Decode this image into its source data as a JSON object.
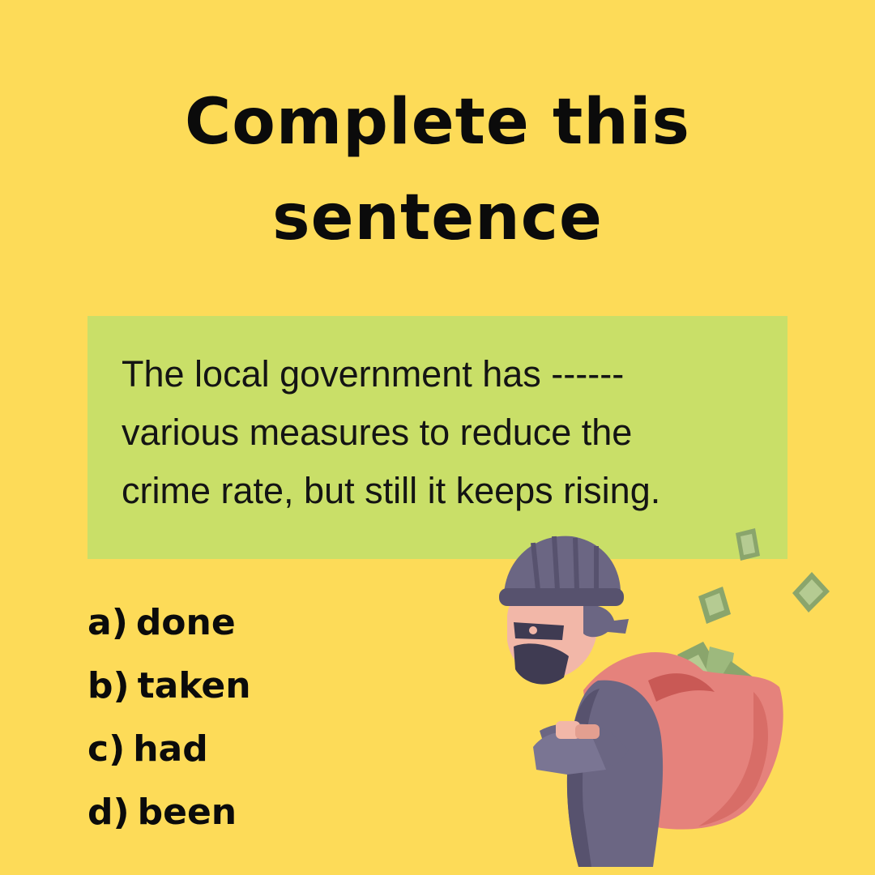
{
  "title": {
    "line1": "Complete this",
    "line2": "sentence"
  },
  "sentence": {
    "line1": "The local government has ------",
    "line2": "various measures to reduce the",
    "line3": "crime rate, but still it keeps rising."
  },
  "options": [
    {
      "letter": "a)",
      "text": "done"
    },
    {
      "letter": "b)",
      "text": "taken"
    },
    {
      "letter": "c)",
      "text": "had"
    },
    {
      "letter": "d)",
      "text": "been"
    }
  ],
  "colors": {
    "background": "#FDDB58",
    "sentence_box": "#C9DF68",
    "text": "#0B0B0B",
    "outfit": "#6B6683",
    "bag": "#E5827C",
    "money": "#8AA56C"
  },
  "illustration": {
    "icon": "thief-with-money-bag-icon"
  }
}
